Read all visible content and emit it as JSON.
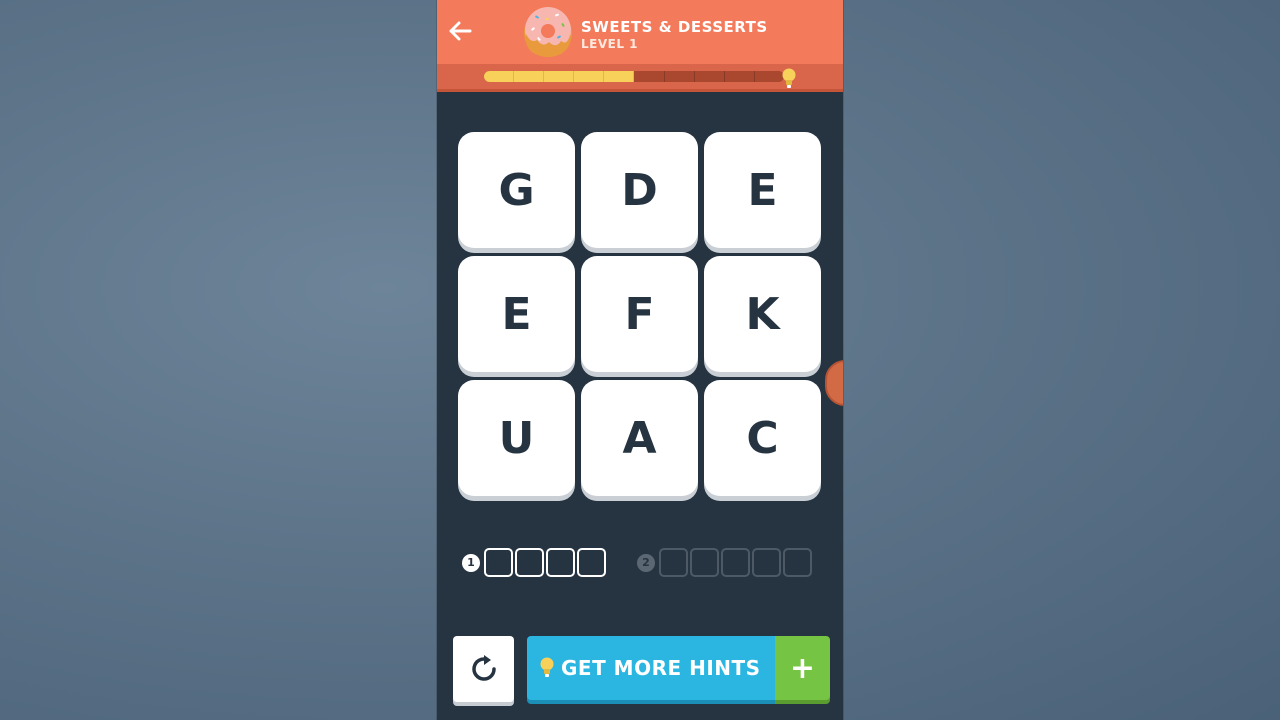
{
  "header": {
    "category_title": "SWEETS & DESSERTS",
    "level_label": "LEVEL 1",
    "back_icon": "arrow-left-icon",
    "category_icon": "donut-icon"
  },
  "progress": {
    "segments_total": 10,
    "segments_filled": 5,
    "fraction": 0.5,
    "goal_icon": "lightbulb-icon",
    "fill_color": "#f7d15a"
  },
  "letter_grid": {
    "letters": [
      "G",
      "D",
      "E",
      "E",
      "F",
      "K",
      "U",
      "A",
      "C"
    ]
  },
  "words": [
    {
      "number": "1",
      "length": 4,
      "active": true
    },
    {
      "number": "2",
      "length": 5,
      "active": false
    }
  ],
  "footer": {
    "refresh_icon": "refresh-icon",
    "hints_label": "GET MORE HINTS",
    "hints_icon": "lightbulb-icon",
    "plus_label": "+"
  },
  "colors": {
    "header_bg": "#f37a5a",
    "board_bg": "#263442",
    "hints_bg": "#2bb6e2",
    "plus_bg": "#76c443"
  }
}
